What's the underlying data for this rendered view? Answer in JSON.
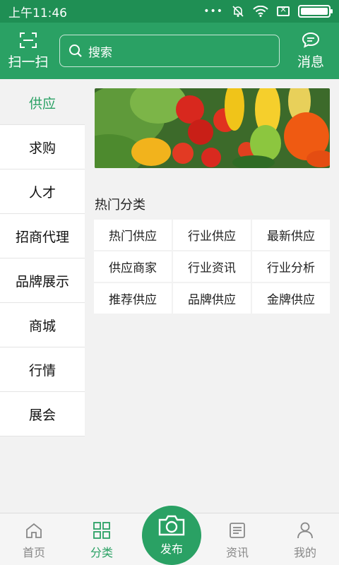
{
  "colors": {
    "brand": "#2aa164",
    "status_bar": "#1f8f54",
    "background": "#f2f2f2"
  },
  "status_bar": {
    "time": "上午11:46",
    "icons": [
      "more-dots-icon",
      "bell-muted-icon",
      "wifi-icon",
      "box-x-icon",
      "battery-icon"
    ],
    "battery_level": 1.0
  },
  "header": {
    "scan_label": "扫一扫",
    "search_placeholder": "搜索",
    "message_label": "消息"
  },
  "sidebar": {
    "items": [
      {
        "label": "供应",
        "active": true
      },
      {
        "label": "求购"
      },
      {
        "label": "人才"
      },
      {
        "label": "招商代理"
      },
      {
        "label": "品牌展示"
      },
      {
        "label": "商城"
      },
      {
        "label": "行情"
      },
      {
        "label": "展会"
      }
    ]
  },
  "content": {
    "section_title": "热门分类",
    "categories": [
      "热门供应",
      "行业供应",
      "最新供应",
      "供应商家",
      "行业资讯",
      "行业分析",
      "推荐供应",
      "品牌供应",
      "金牌供应"
    ]
  },
  "bottom_nav": {
    "items": [
      {
        "label": "首页",
        "icon": "home-icon"
      },
      {
        "label": "分类",
        "icon": "grid-icon",
        "active": true
      },
      {
        "label": "资讯",
        "icon": "news-icon"
      },
      {
        "label": "我的",
        "icon": "person-icon"
      }
    ],
    "publish_label": "发布"
  }
}
